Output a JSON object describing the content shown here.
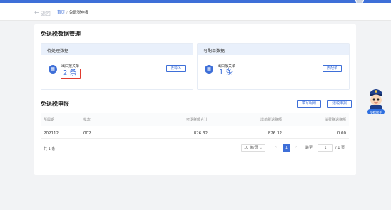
{
  "nav": {
    "back_label": "返回",
    "home_label": "首页",
    "separator": "/",
    "current_page": "免退税申报"
  },
  "section1": {
    "title": "免退税数据管理",
    "pending": {
      "header": "待处理数据",
      "badge_glyph": "▦",
      "label": "出口报关单",
      "count": "2 条",
      "button": "去导入"
    },
    "matchable": {
      "header": "可配单数据",
      "badge_glyph": "▦",
      "label": "出口报关单",
      "count": "1 条",
      "button": "去配单"
    }
  },
  "section2": {
    "title": "免退税申报",
    "fill_button": "填写明细",
    "refund_button": "退税申报",
    "columns": [
      "所属期",
      "批次",
      "可退税额合计",
      "增值税退税额",
      "消费税退税额"
    ],
    "rows": [
      [
        "202112",
        "002",
        "826.32",
        "826.32",
        "0.00"
      ]
    ],
    "total_text": "共 1 条",
    "pagination": {
      "page_size": "10 条/页",
      "prev": "‹",
      "current_page": "1",
      "next": "›",
      "goto_label": "跳至",
      "goto_value": "1",
      "total_pages": "/ 1 页"
    }
  },
  "mascot": {
    "label": "小税帮手"
  },
  "colors": {
    "accent": "#3e6fd8",
    "highlight_box": "#e03b2f",
    "panel_header": "#e9f0fb"
  }
}
